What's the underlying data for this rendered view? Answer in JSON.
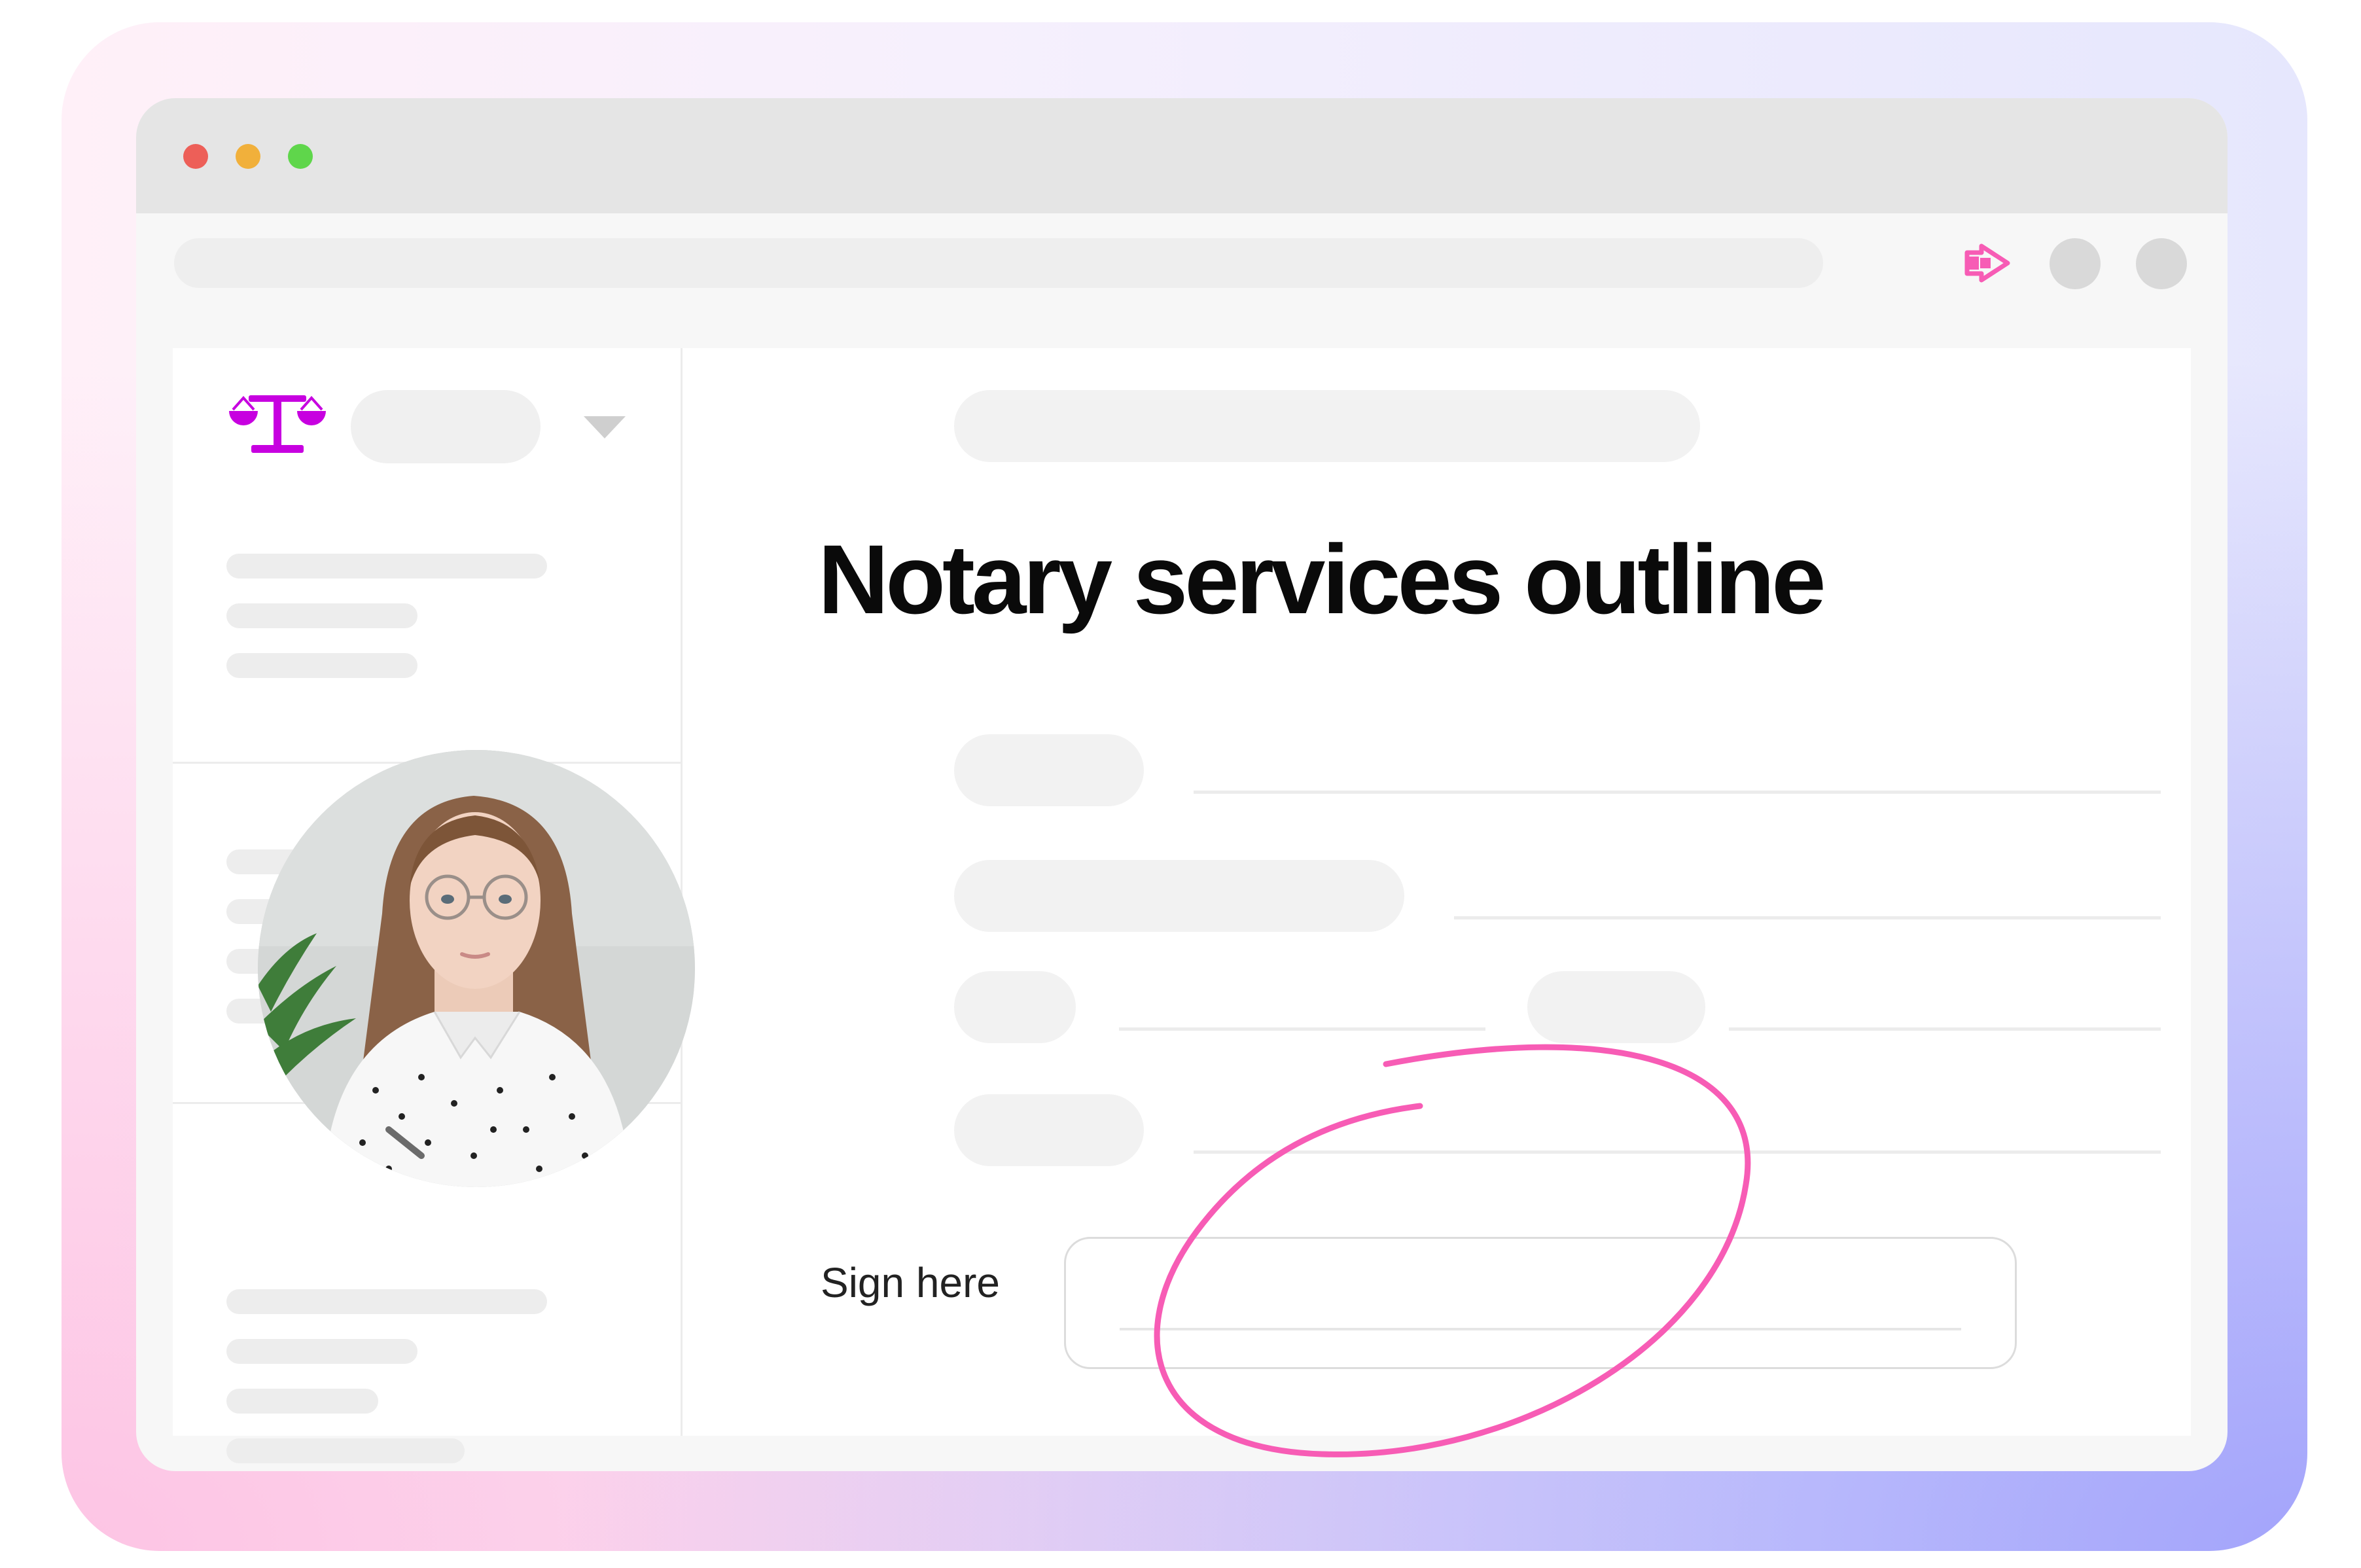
{
  "document": {
    "title": "Notary services outline",
    "sign_label": "Sign here",
    "signature_value": ""
  },
  "colors": {
    "brand": "#c700e0",
    "highlight": "#f75cb5",
    "extension": "#f75cb5",
    "traffic_close": "#ed5f58",
    "traffic_minimize": "#f1b03b",
    "traffic_maximize": "#5fd64b"
  },
  "icons": {
    "logo": "scales-of-justice-icon",
    "dropdown": "chevron-down-icon",
    "extension": "arrow-right-extension-icon"
  },
  "avatar": {
    "description_icon": "user-avatar-photo"
  }
}
